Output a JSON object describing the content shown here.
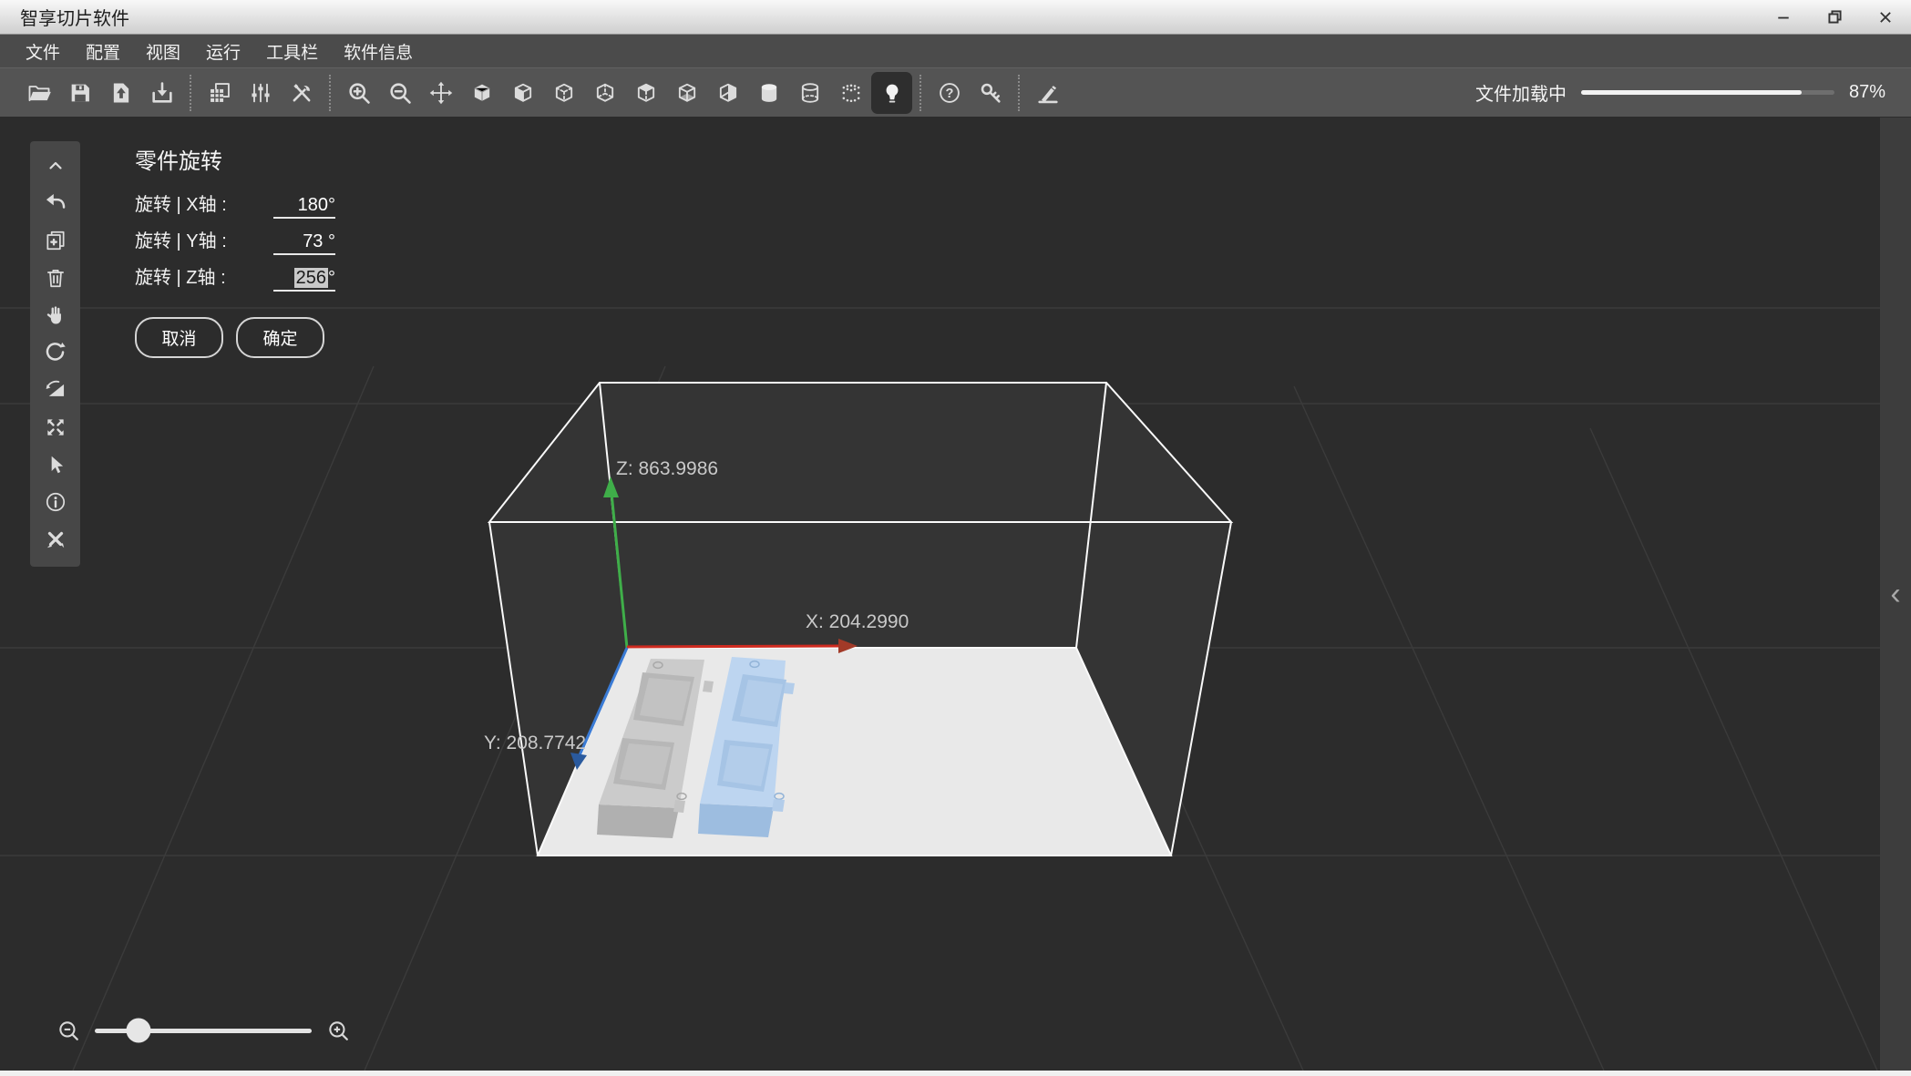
{
  "window": {
    "title": "智享切片软件",
    "control_icon_names": [
      "minimize",
      "restore",
      "close"
    ]
  },
  "menu": {
    "items": [
      "文件",
      "配置",
      "视图",
      "运行",
      "工具栏",
      "软件信息"
    ]
  },
  "toolbar": {
    "icon_names": [
      "open-file",
      "save-file",
      "import-model",
      "export-model",
      "copy-plate",
      "adjust-params",
      "tools",
      "zoom-in",
      "zoom-out",
      "move",
      "view-cube-solid",
      "view-cube-face",
      "view-cube-wire-a",
      "view-cube-wire-b",
      "view-cube-wire-c",
      "view-cube-wire-d",
      "view-cube-section",
      "view-cylinder-solid",
      "view-cylinder-wire",
      "view-point-cloud",
      "light-toggle",
      "help",
      "license-key",
      "measure-pen"
    ],
    "active_icon": "light-toggle",
    "progress": {
      "label": "文件加载中",
      "percent_text": "87%",
      "value": 87,
      "fill_style": "width:87%"
    }
  },
  "sidebar": {
    "icon_names": [
      "collapse-up",
      "undo",
      "add-part",
      "delete-part",
      "pan-hand",
      "rotate-view",
      "mirror-part",
      "fit-view",
      "select-cursor",
      "part-info",
      "repair-part"
    ]
  },
  "rotation_panel": {
    "title": "零件旋转",
    "rows": [
      {
        "label": "旋转 | X轴 :",
        "value": "180",
        "unit": "°",
        "selected": false
      },
      {
        "label": "旋转 | Y轴 :",
        "value": "73",
        "unit": "°",
        "selected": false
      },
      {
        "label": "旋转 | Z轴 :",
        "value": "256",
        "unit": "°",
        "selected": true
      }
    ],
    "cancel_label": "取消",
    "confirm_label": "确定"
  },
  "viewport": {
    "axis_labels": {
      "z": "Z: 863.9986",
      "x": "X: 204.2990",
      "y": "Y: 208.7742"
    },
    "axis_colors": {
      "x": "#cf2b20",
      "y": "#3a7bd5",
      "z": "#3fae49"
    },
    "build_plate_color": "#e9e9e9",
    "models": [
      {
        "name": "part-left",
        "color": "#cbcbcb"
      },
      {
        "name": "part-right",
        "color": "#bdd5f0"
      }
    ]
  },
  "zoom_control": {
    "thumb_style": "left:20%",
    "value_percent": 20
  },
  "right_panel": {
    "chevron": "‹"
  },
  "icons": {
    "help_glyph": "?",
    "info_glyph": "i"
  }
}
